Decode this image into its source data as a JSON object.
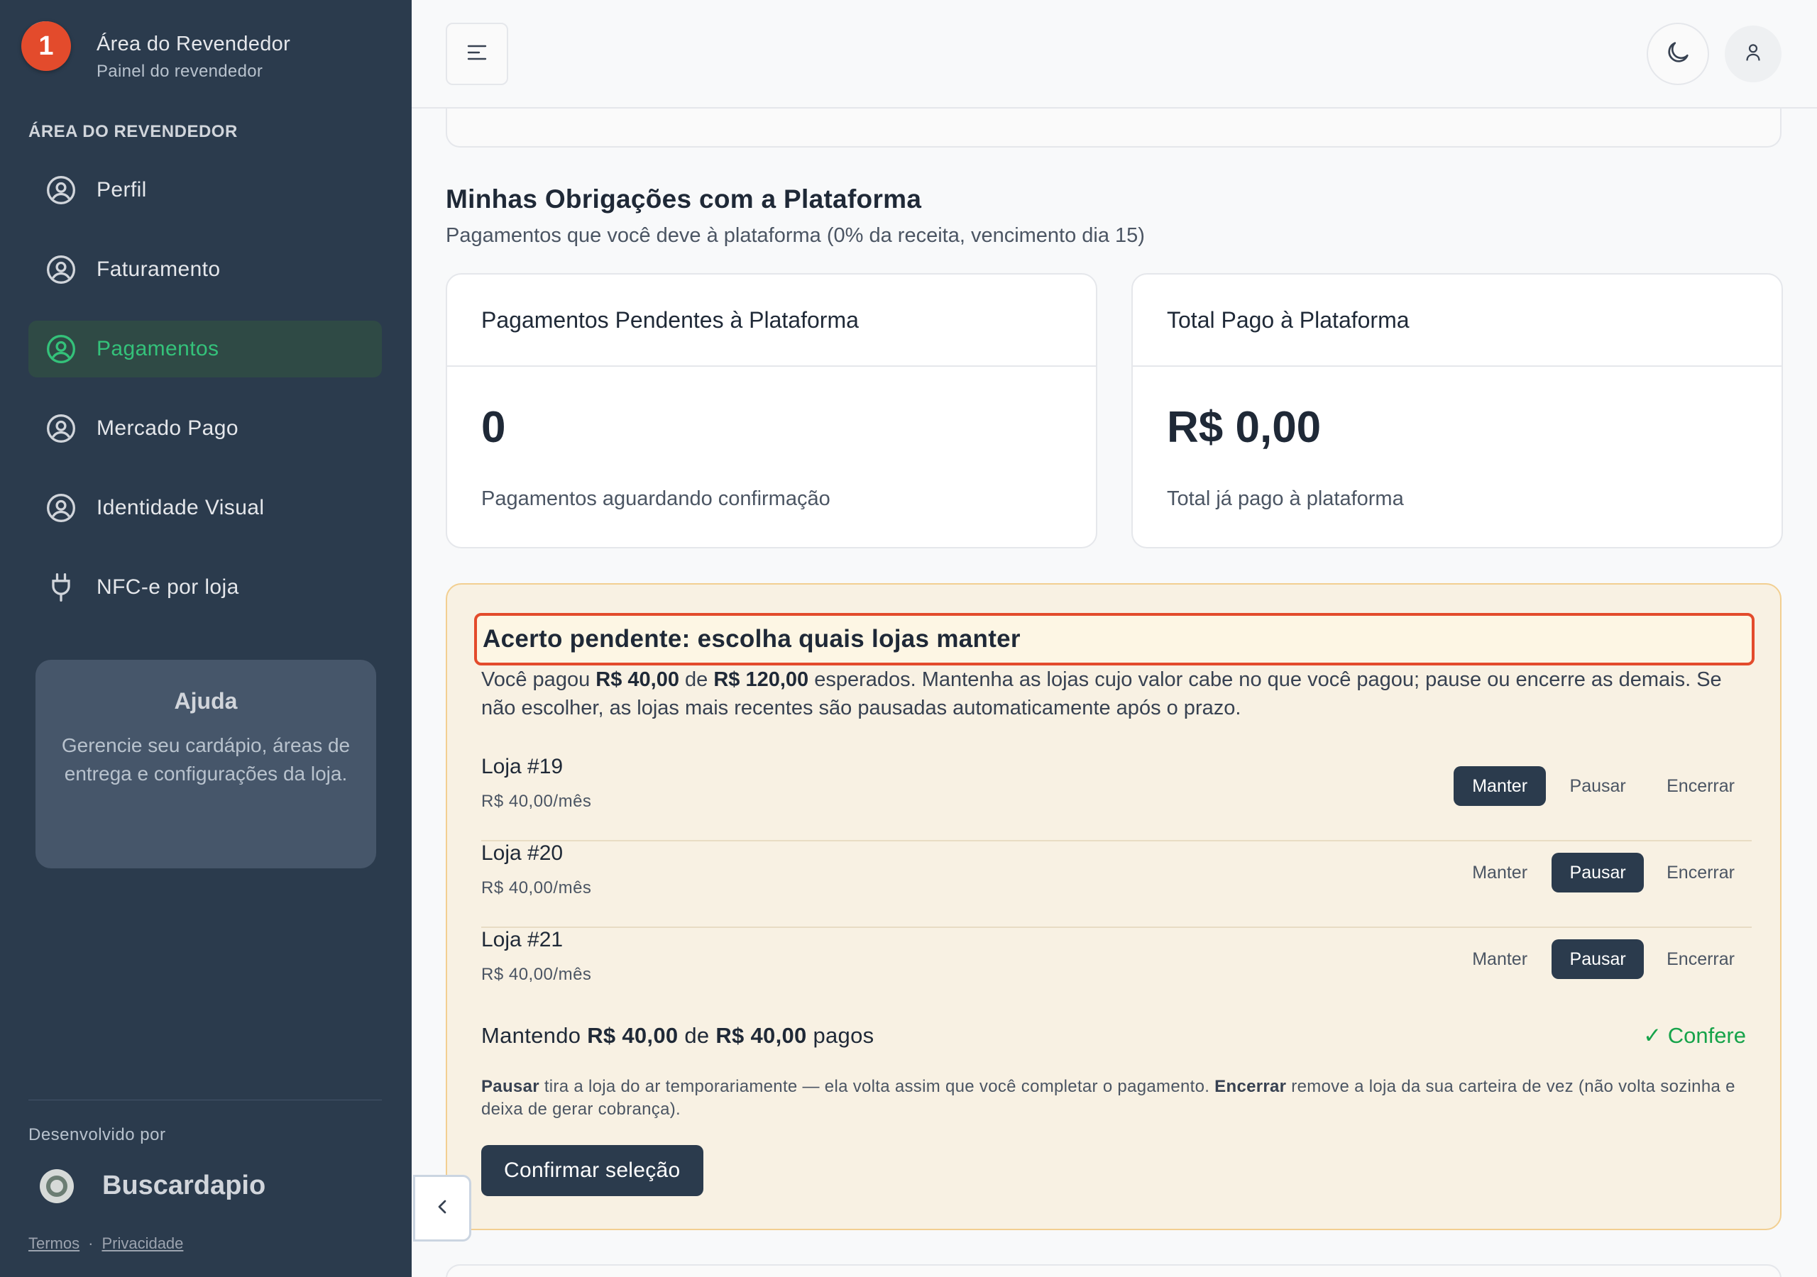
{
  "sidebar": {
    "badge_count": "1",
    "brand_title": "Área do Revendedor",
    "brand_subtitle": "Painel do revendedor",
    "section_label": "ÁREA DO REVENDEDOR",
    "items": [
      {
        "label": "Perfil",
        "icon": "user-circle-icon",
        "active": false
      },
      {
        "label": "Faturamento",
        "icon": "user-circle-icon",
        "active": false
      },
      {
        "label": "Pagamentos",
        "icon": "user-circle-icon",
        "active": true
      },
      {
        "label": "Mercado Pago",
        "icon": "user-circle-icon",
        "active": false
      },
      {
        "label": "Identidade Visual",
        "icon": "user-circle-icon",
        "active": false
      },
      {
        "label": "NFC-e por loja",
        "icon": "plug-icon",
        "active": false
      }
    ],
    "help": {
      "title": "Ajuda",
      "text": "Gerencie seu cardápio, áreas de entrega e configurações da loja."
    },
    "developed_by": "Desenvolvido por",
    "developer_name": "Buscardapio",
    "links": {
      "terms": "Termos",
      "separator": "·",
      "privacy": "Privacidade"
    }
  },
  "topbar": {
    "icons": {
      "menu": "menu-icon",
      "theme": "moon-icon",
      "user": "user-icon"
    }
  },
  "obligations": {
    "title": "Minhas Obrigações com a Plataforma",
    "subtitle": "Pagamentos que você deve à plataforma (0% da receita, vencimento dia 15)",
    "pending_card": {
      "title": "Pagamentos Pendentes à Plataforma",
      "value": "0",
      "description": "Pagamentos aguardando confirmação"
    },
    "paid_card": {
      "title": "Total Pago à Plataforma",
      "value": "R$ 0,00",
      "description": "Total já pago à plataforma"
    }
  },
  "settlement": {
    "title": "Acerto pendente: escolha quais lojas manter",
    "desc_1": "Você pagou ",
    "paid_amount": "R$ 40,00",
    "desc_2": " de ",
    "expected_amount": "R$ 120,00",
    "desc_3": " esperados. Mantenha as lojas cujo valor cabe no que você pagou; pause ou encerre as demais. Se não escolher, as lojas mais recentes são pausadas automaticamente após o prazo.",
    "option_labels": {
      "keep": "Manter",
      "pause": "Pausar",
      "end": "Encerrar"
    },
    "stores": [
      {
        "name": "Loja #19",
        "price": "R$ 40,00/mês",
        "selected": "keep"
      },
      {
        "name": "Loja #20",
        "price": "R$ 40,00/mês",
        "selected": "pause"
      },
      {
        "name": "Loja #21",
        "price": "R$ 40,00/mês",
        "selected": "pause"
      }
    ],
    "summary_prefix": "Mantendo ",
    "summary_kept": "R$ 40,00",
    "summary_mid": " de ",
    "summary_paid": "R$ 40,00",
    "summary_suffix": " pagos",
    "status": "✓ Confere",
    "status_color": "#16a34a",
    "note_pause_label": "Pausar",
    "note_pause_text": " tira a loja do ar temporariamente — ela volta assim que você completar o pagamento. ",
    "note_end_label": "Encerrar",
    "note_end_text": " remove a loja da sua carteira de vez (não volta sozinha e deixa de gerar cobrança).",
    "confirm_label": "Confirmar seleção"
  },
  "colors": {
    "sidebar_bg": "#2b3b4d",
    "accent_green": "#34c27a",
    "badge_red": "#e34b2c",
    "settlement_bg": "#f8f1e3"
  }
}
